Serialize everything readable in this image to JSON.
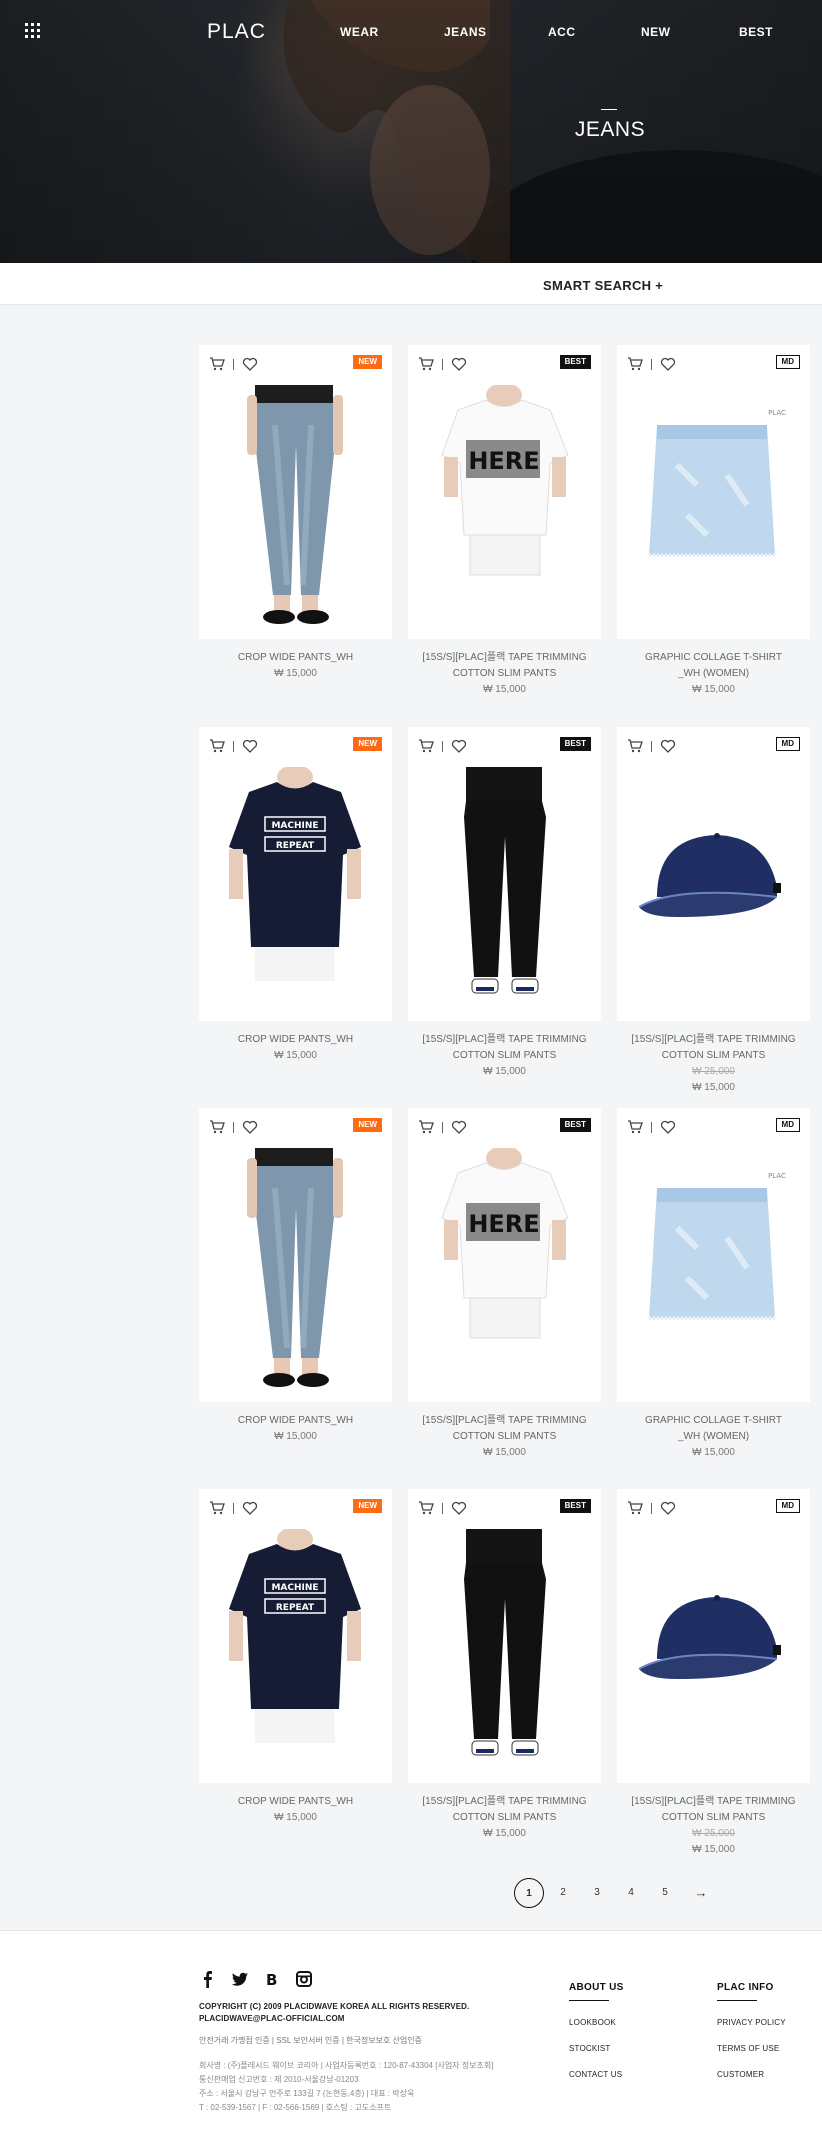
{
  "header": {
    "logo": "PLAC",
    "nav": [
      "WEAR",
      "JEANS",
      "ACC",
      "NEW",
      "BEST"
    ],
    "hero_title": "JEANS"
  },
  "smart_search": "SMART SEARCH +",
  "products": [
    {
      "badge": "NEW",
      "name1": "CROP WIDE PANTS_WH",
      "name2": "",
      "old_price": "",
      "price": "₩ 15,000",
      "image": "jeans"
    },
    {
      "badge": "BEST",
      "name1": "[15S/S][PLAC]플랙 TAPE TRIMMING",
      "name2": "COTTON SLIM PANTS",
      "old_price": "",
      "price": "₩ 15,000",
      "image": "tshirt-white"
    },
    {
      "badge": "MD",
      "name1": "GRAPHIC COLLAGE T-SHIRT",
      "name2": "_WH (WOMEN)",
      "old_price": "",
      "price": "₩ 15,000",
      "image": "skirt"
    },
    {
      "badge": "NEW",
      "name1": "CROP WIDE PANTS_WH",
      "name2": "",
      "old_price": "",
      "price": "₩ 15,000",
      "image": "tshirt-navy"
    },
    {
      "badge": "BEST",
      "name1": "[15S/S][PLAC]플랙 TAPE TRIMMING",
      "name2": "COTTON SLIM PANTS",
      "old_price": "",
      "price": "₩ 15,000",
      "image": "black-pants"
    },
    {
      "badge": "MD",
      "name1": "[15S/S][PLAC]플랙 TAPE TRIMMING",
      "name2": "COTTON SLIM PANTS",
      "old_price": "₩ 25,000",
      "price": "₩ 15,000",
      "image": "cap"
    },
    {
      "badge": "NEW",
      "name1": "CROP WIDE PANTS_WH",
      "name2": "",
      "old_price": "",
      "price": "₩ 15,000",
      "image": "jeans"
    },
    {
      "badge": "BEST",
      "name1": "[15S/S][PLAC]플랙 TAPE TRIMMING",
      "name2": "COTTON SLIM PANTS",
      "old_price": "",
      "price": "₩ 15,000",
      "image": "tshirt-white"
    },
    {
      "badge": "MD",
      "name1": "GRAPHIC COLLAGE T-SHIRT",
      "name2": "_WH (WOMEN)",
      "old_price": "",
      "price": "₩ 15,000",
      "image": "skirt"
    },
    {
      "badge": "NEW",
      "name1": "CROP WIDE PANTS_WH",
      "name2": "",
      "old_price": "",
      "price": "₩ 15,000",
      "image": "tshirt-navy"
    },
    {
      "badge": "BEST",
      "name1": "[15S/S][PLAC]플랙 TAPE TRIMMING",
      "name2": "COTTON SLIM PANTS",
      "old_price": "",
      "price": "₩ 15,000",
      "image": "black-pants"
    },
    {
      "badge": "MD",
      "name1": "[15S/S][PLAC]플랙 TAPE TRIMMING",
      "name2": "COTTON SLIM PANTS",
      "old_price": "₩ 25,000",
      "price": "₩ 15,000",
      "image": "cap"
    }
  ],
  "tshirt_text": {
    "here": "HERE",
    "machine": "MACHINE",
    "repeat": "REPEAT"
  },
  "pagination": [
    "1",
    "2",
    "3",
    "4",
    "5",
    "→"
  ],
  "footer": {
    "copyright": "COPYRIGHT (C) 2009 PLACIDWAVE KOREA  ALL RIGHTS RESERVED.",
    "email": "PLACIDWAVE@PLAC-OFFICIAL.COM",
    "cert": "안전거래 가맹점 인증   |   SSL 보안서버 인증   |   한국정보보호 산업인증",
    "info": [
      "회사명 : (주)플레시드 웨이브 코리아   |   사업자등록번호 : 120-87-43304 [사업자 정보조회]",
      "통신판매업 신고번호 : 제 2010-서울강남-01203",
      "주소 : 서울시 강남구 언주로 133길 7 (논현동,4층)   |   대표 : 박상욱",
      "T : 02-539-1567   |   F : 02-566-1569   |   호스팅 : 고도소프트"
    ],
    "about_title": "ABOUT US",
    "about_links": [
      "LOOKBOOK",
      "STOCKIST",
      "CONTACT US"
    ],
    "info_title": "PLAC INFO",
    "info_links": [
      "PRIVACY POLICY",
      "TERMS OF USE",
      "CUSTOMER"
    ],
    "social_icons": [
      "facebook-icon",
      "twitter-icon",
      "blog-icon",
      "instagram-icon"
    ]
  }
}
